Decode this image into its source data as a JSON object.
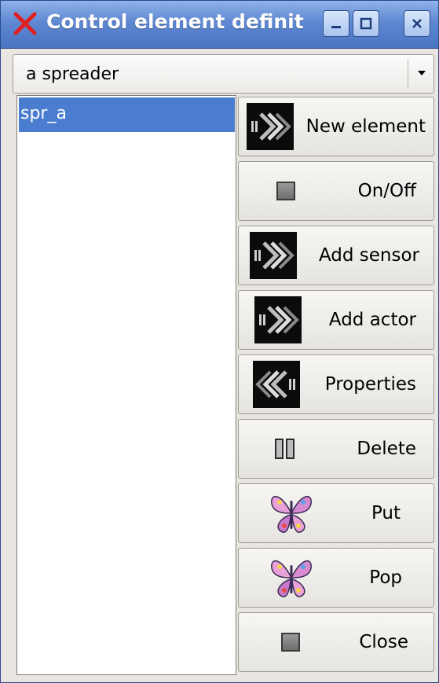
{
  "window": {
    "title": "Control element definit"
  },
  "selector": {
    "value": "a spreader"
  },
  "list": {
    "items": [
      "spr_a"
    ],
    "selected_index": 0
  },
  "buttons": {
    "new_element": "New element",
    "on_off": "On/Off",
    "add_sensor": "Add sensor",
    "add_actor": "Add actor",
    "properties": "Properties",
    "delete": "Delete",
    "put": "Put",
    "pop": "Pop",
    "close": "Close"
  },
  "icons": {
    "app": "red-x-icon",
    "forward": "forward-arrows-icon",
    "backward": "backward-arrows-icon",
    "toggle": "square-icon",
    "pause": "pause-icon",
    "butterfly": "butterfly-icon"
  },
  "colors": {
    "titlebar": "#5f88d2",
    "selection": "#4a7dcf",
    "app_icon": "#e02020"
  }
}
